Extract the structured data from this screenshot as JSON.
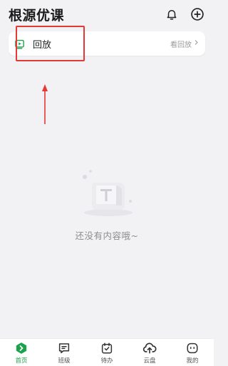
{
  "header": {
    "title": "根源优课",
    "bell_icon": "bell-icon",
    "add_icon": "plus-circle-icon"
  },
  "replay": {
    "label": "回放",
    "link_label": "看回放",
    "icon": "video-play-icon",
    "chevron_icon": "chevron-right-icon"
  },
  "empty": {
    "message": "还没有内容哦~",
    "icon": "empty-box-illustration"
  },
  "tabs": [
    {
      "label": "首页",
      "icon": "home-hexagon-icon",
      "active": true
    },
    {
      "label": "班级",
      "icon": "class-chat-icon",
      "active": false
    },
    {
      "label": "待办",
      "icon": "todo-check-icon",
      "active": false
    },
    {
      "label": "云盘",
      "icon": "cloud-upload-icon",
      "active": false
    },
    {
      "label": "我的",
      "icon": "profile-face-icon",
      "active": false
    }
  ],
  "colors": {
    "accent": "#1aa34a",
    "highlight": "#e53935",
    "background": "#f2f2f4"
  }
}
